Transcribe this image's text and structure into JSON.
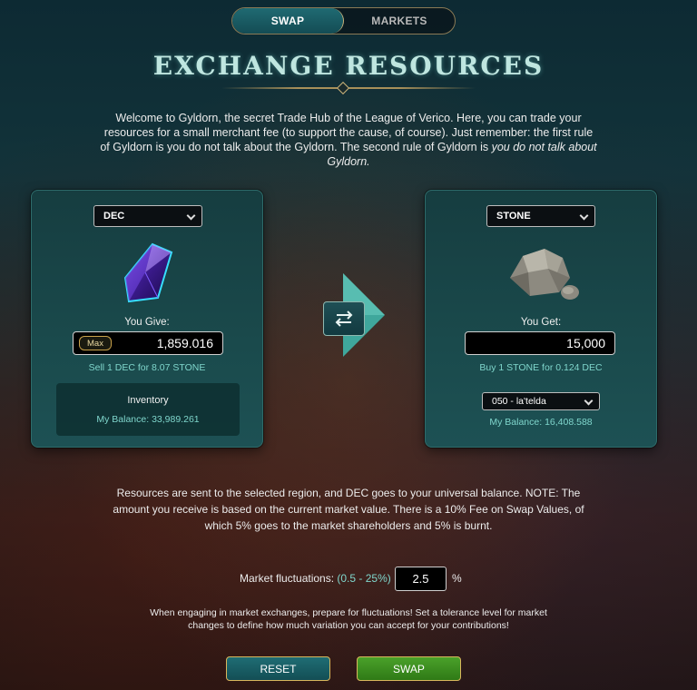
{
  "tabs": {
    "swap": "SWAP",
    "markets": "MARKETS"
  },
  "title": "EXCHANGE RESOURCES",
  "intro": {
    "text": "Welcome to Gyldorn, the secret Trade Hub of the League of Verico. Here, you can trade your resources for a small merchant fee (to support the cause, of course). Just remember: the first rule of Gyldorn is you do not talk about the Gyldorn. The second rule of Gyldorn is ",
    "emphasis": "you do not talk about Gyldorn."
  },
  "give": {
    "currency": "DEC",
    "label": "You Give:",
    "max_label": "Max",
    "amount": "1,859.016",
    "rate": "Sell 1 DEC for 8.07 STONE",
    "inventory_label": "Inventory",
    "balance": "My Balance: 33,989.261"
  },
  "get": {
    "resource": "STONE",
    "label": "You Get:",
    "amount": "15,000",
    "rate": "Buy 1 STONE for 0.124 DEC",
    "region": "050 - la'telda",
    "balance": "My Balance: 16,408.588"
  },
  "note": "Resources are sent to the selected region, and DEC goes to your universal balance. NOTE: The amount you receive is based on the current market value. There is a 10% Fee on Swap Values, of which 5% goes to the market shareholders and 5% is burnt.",
  "fluctuation": {
    "label": "Market fluctuations:",
    "range": "(0.5 - 25%)",
    "value": "2.5",
    "unit": "%"
  },
  "warning": "When engaging in market exchanges, prepare for fluctuations! Set a tolerance level for market changes to define how much variation you can accept for your contributions!",
  "buttons": {
    "reset": "RESET",
    "swap": "SWAP"
  },
  "icons": {
    "dec": "purple-crystal-icon",
    "stone": "stone-icon",
    "swap": "swap-arrows-icon",
    "dropdown": "chevron-down-icon"
  },
  "colors": {
    "accent": "#7fd6cc",
    "gold": "#c9a24a",
    "swap_green": "#4aa12a",
    "teal": "#1f6d74"
  }
}
